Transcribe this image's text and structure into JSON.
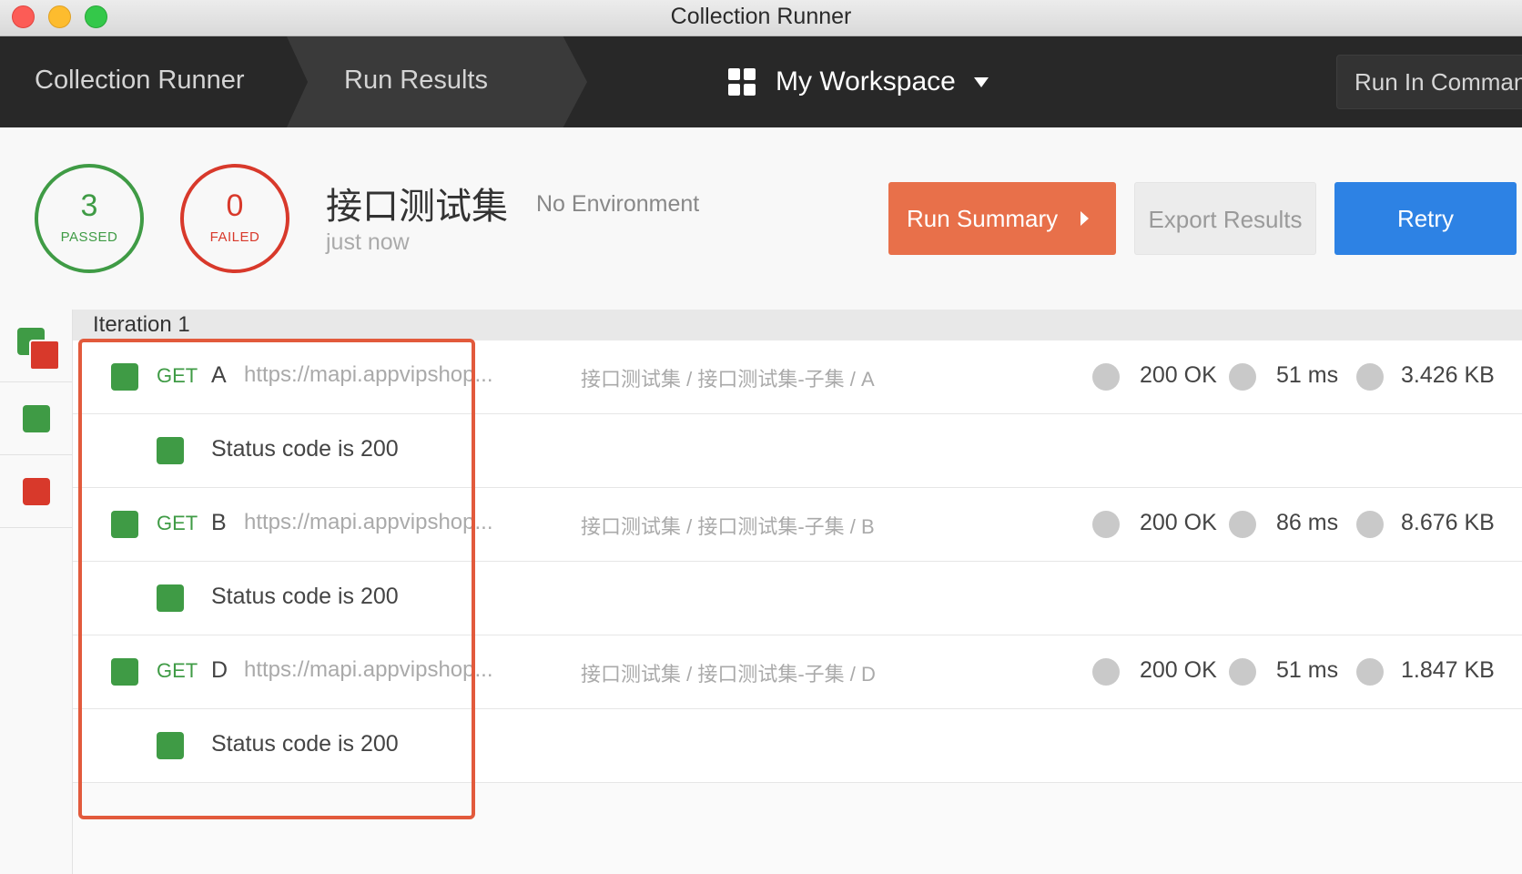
{
  "window": {
    "title": "Collection Runner"
  },
  "nav": {
    "crumb_back": "Collection Runner",
    "crumb_current": "Run Results",
    "workspace": "My Workspace",
    "run_cmd": "Run In Command Line"
  },
  "summary": {
    "passed_count": "3",
    "passed_label": "PASSED",
    "failed_count": "0",
    "failed_label": "FAILED",
    "collection": "接口测试集",
    "environment": "No Environment",
    "time": "just now",
    "run_summary_label": "Run Summary",
    "export_label": "Export Results",
    "retry_label": "Retry"
  },
  "iteration": {
    "label": "Iteration 1"
  },
  "requests": [
    {
      "method": "GET",
      "name": "A",
      "url": "https://mapi.appvipshop...",
      "path": "接口测试集 / 接口测试集-子集 / A",
      "status": "200 OK",
      "time": "51 ms",
      "size": "3.426 KB",
      "test": "Status code is 200"
    },
    {
      "method": "GET",
      "name": "B",
      "url": "https://mapi.appvipshop...",
      "path": "接口测试集 / 接口测试集-子集 / B",
      "status": "200 OK",
      "time": "86 ms",
      "size": "8.676 KB",
      "test": "Status code is 200"
    },
    {
      "method": "GET",
      "name": "D",
      "url": "https://mapi.appvipshop...",
      "path": "接口测试集 / 接口测试集-子集 / D",
      "status": "200 OK",
      "time": "51 ms",
      "size": "1.847 KB",
      "test": "Status code is 200"
    }
  ],
  "colors": {
    "pass": "#3f9b45",
    "fail": "#d8392b",
    "run_summary": "#e8704a",
    "retry": "#2d82e4",
    "highlight": "#e25a3c"
  }
}
